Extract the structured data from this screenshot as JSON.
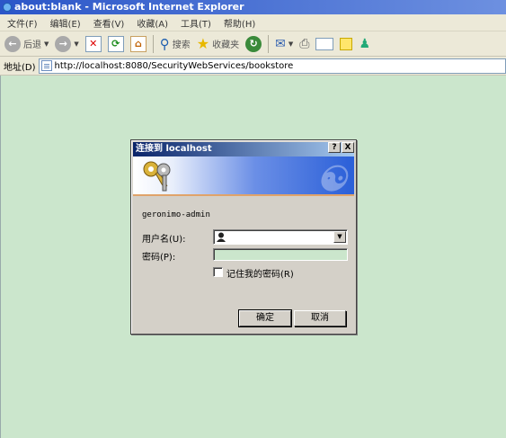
{
  "window": {
    "title": "about:blank - Microsoft Internet Explorer"
  },
  "menu": [
    "文件(F)",
    "编辑(E)",
    "查看(V)",
    "收藏(A)",
    "工具(T)",
    "帮助(H)"
  ],
  "toolbar": {
    "back": "后退",
    "search": "搜索",
    "favorites": "收藏夹"
  },
  "address": {
    "label": "地址(D)",
    "url": "http://localhost:8080/SecurityWebServices/bookstore"
  },
  "dialog": {
    "title": "连接到 localhost",
    "help_btn": "?",
    "close_btn": "X",
    "realm": "geronimo-admin",
    "username_label": "用户名(U):",
    "password_label": "密码(P):",
    "remember_label": "记住我的密码(R)",
    "remember_checked": false,
    "ok": "确定",
    "cancel": "取消"
  },
  "colors": {
    "page_bg": "#cbe6cc",
    "title_blue": "#2b56c8",
    "dialog_bg": "#d4d0c8"
  }
}
